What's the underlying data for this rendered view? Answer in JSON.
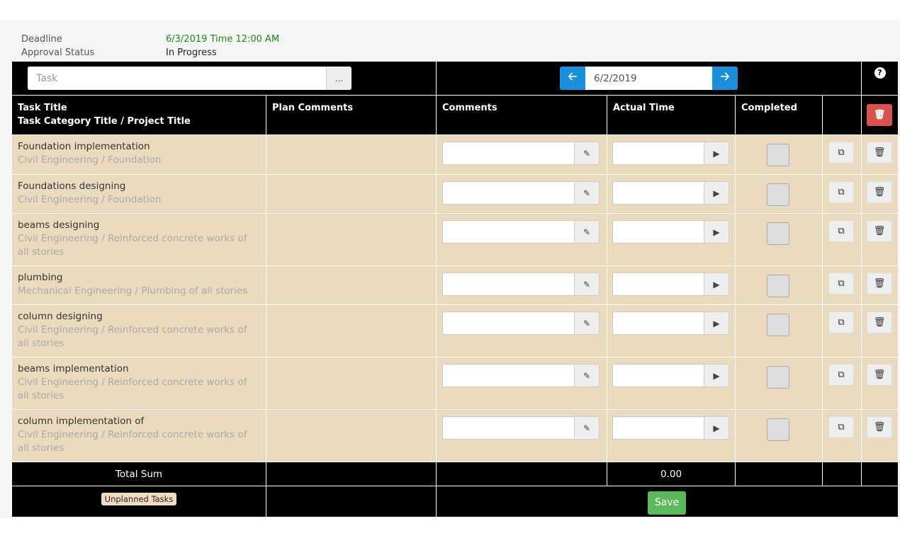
{
  "info": {
    "deadline_label": "Deadline",
    "deadline_value": "6/3/2019 Time 12:00 AM",
    "status_label": "Approval Status",
    "status_value": "In Progress"
  },
  "toolbar": {
    "task_placeholder": "Task",
    "dots_label": "...",
    "date_value": "6/2/2019"
  },
  "headers": {
    "task_title": "Task Title",
    "task_sub": "Task Category Title  / Project Title",
    "plan_comments": "Plan Comments",
    "comments": "Comments",
    "actual_time": "Actual Time",
    "completed": "Completed"
  },
  "tasks": [
    {
      "title": "Foundation implementation",
      "category": "Civil Engineering  / Foundation"
    },
    {
      "title": "Foundations designing",
      "category": "Civil Engineering  / Foundation"
    },
    {
      "title": "beams designing",
      "category": "Civil Engineering  / Reinforced concrete works of all stories"
    },
    {
      "title": "plumbing",
      "category": "Mechanical Engineering  / Plumbing of all stories"
    },
    {
      "title": "column designing",
      "category": "Civil Engineering  / Reinforced concrete works of all stories"
    },
    {
      "title": "beams implementation",
      "category": "Civil Engineering  / Reinforced concrete works of all stories"
    },
    {
      "title": "column implementation of",
      "category": "Civil Engineering  / Reinforced concrete works of all stories"
    }
  ],
  "footer": {
    "total_label": "Total Sum",
    "total_value": "0.00",
    "unplanned_label": "Unplanned Tasks",
    "save_label": "Save"
  }
}
